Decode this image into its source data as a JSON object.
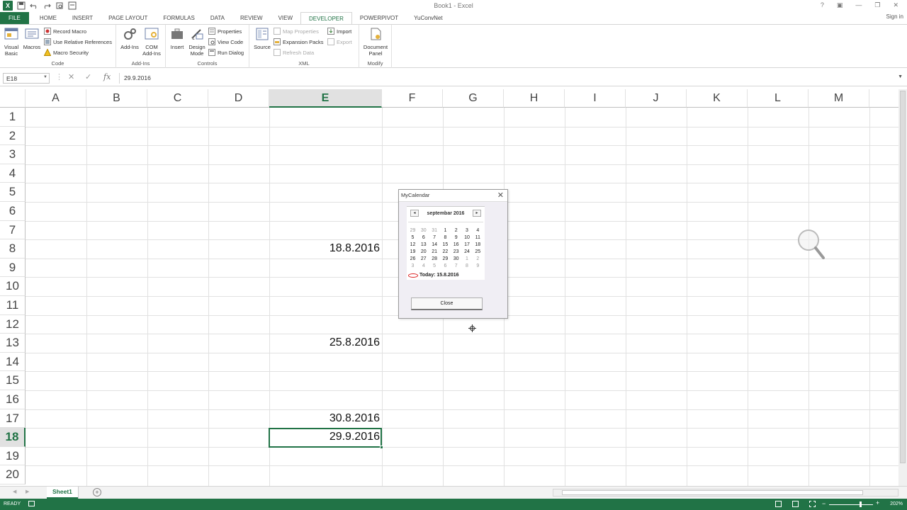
{
  "window": {
    "title": "Book1 - Excel",
    "sign_in": "Sign in"
  },
  "tabs": [
    "FILE",
    "HOME",
    "INSERT",
    "PAGE LAYOUT",
    "FORMULAS",
    "DATA",
    "REVIEW",
    "VIEW",
    "DEVELOPER",
    "POWERPIVOT",
    "YuConvNet"
  ],
  "active_tab": "DEVELOPER",
  "ribbon": {
    "code": {
      "label": "Code",
      "visual_basic": "Visual Basic",
      "macros": "Macros",
      "record_macro": "Record Macro",
      "relative_refs": "Use Relative References",
      "macro_security": "Macro Security"
    },
    "addins": {
      "label": "Add-Ins",
      "addins": "Add-Ins",
      "com_addins": "COM Add-Ins"
    },
    "controls": {
      "label": "Controls",
      "insert": "Insert",
      "design_mode": "Design Mode",
      "properties": "Properties",
      "view_code": "View Code",
      "run_dialog": "Run Dialog"
    },
    "xml": {
      "label": "XML",
      "source": "Source",
      "map_properties": "Map Properties",
      "expansion_packs": "Expansion Packs",
      "refresh_data": "Refresh Data",
      "import": "Import",
      "export": "Export"
    },
    "modify": {
      "label": "Modify",
      "document_panel": "Document Panel"
    }
  },
  "formula_bar": {
    "name_box": "E18",
    "formula": "29.9.2016"
  },
  "columns": [
    "A",
    "B",
    "C",
    "D",
    "E",
    "F",
    "G",
    "H",
    "I",
    "J",
    "K",
    "L",
    "M"
  ],
  "rows": [
    "1",
    "2",
    "3",
    "4",
    "5",
    "6",
    "7",
    "8",
    "9",
    "10",
    "11",
    "12",
    "13",
    "14",
    "15",
    "16",
    "17",
    "18",
    "19",
    "20"
  ],
  "selected_column": "E",
  "selected_row": "18",
  "cells": {
    "E8": "18.8.2016",
    "E13": "25.8.2016",
    "E17": "30.8.2016",
    "E18": "29.9.2016"
  },
  "dialog": {
    "title": "MyCalendar",
    "month_label": "septembar 2016",
    "weeks": [
      [
        "29",
        "30",
        "31",
        "1",
        "2",
        "3",
        "4"
      ],
      [
        "5",
        "6",
        "7",
        "8",
        "9",
        "10",
        "11"
      ],
      [
        "12",
        "13",
        "14",
        "15",
        "16",
        "17",
        "18"
      ],
      [
        "19",
        "20",
        "21",
        "22",
        "23",
        "24",
        "25"
      ],
      [
        "26",
        "27",
        "28",
        "29",
        "30",
        "1",
        "2"
      ],
      [
        "3",
        "4",
        "5",
        "6",
        "7",
        "8",
        "9"
      ]
    ],
    "today_label": "Today: 15.8.2016",
    "close_button": "Close"
  },
  "sheet_tab": "Sheet1",
  "status": {
    "ready": "READY",
    "zoom": "202%"
  },
  "colors": {
    "accent": "#217346"
  }
}
